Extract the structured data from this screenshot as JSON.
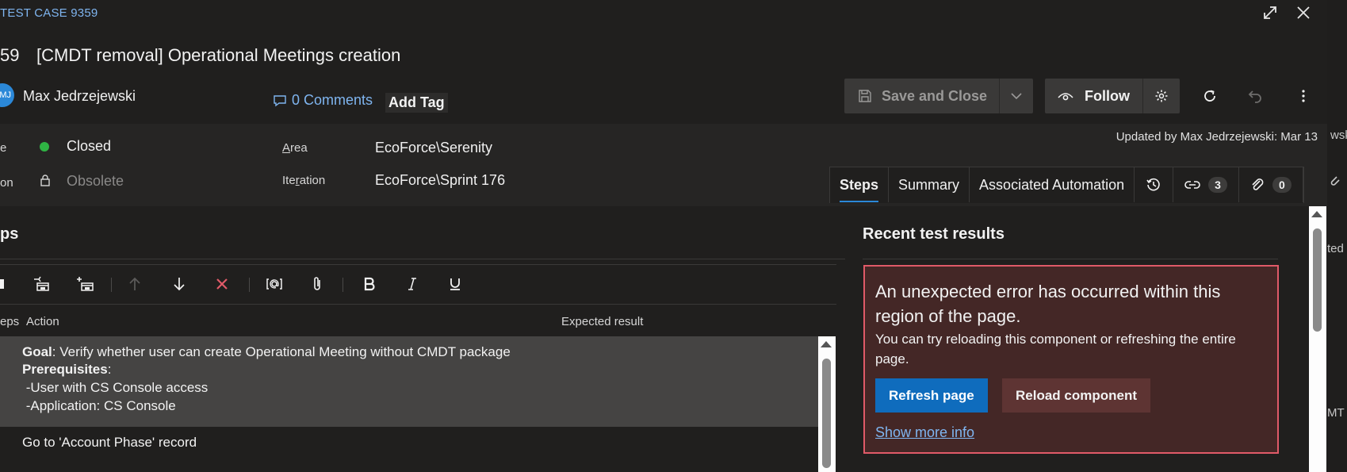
{
  "header": {
    "type_label": "TEST CASE 9359",
    "id_fragment": "59",
    "title": "[CMDT removal] Operational Meetings creation"
  },
  "assignee": {
    "initials": "MJ",
    "name": "Max Jedrzejewski"
  },
  "comments": {
    "label": "0 Comments"
  },
  "add_tag": {
    "label": "Add Tag"
  },
  "toolbar": {
    "save_label": "Save and Close",
    "follow_label": "Follow"
  },
  "fields": {
    "state_label": "e",
    "state_value": "Closed",
    "reason_label": "on",
    "reason_value": "Obsolete",
    "area_label_prefix": "",
    "area_label_access": "A",
    "area_label_rest": "rea",
    "area_value": "EcoForce\\Serenity",
    "iteration_label_pre": "Ite",
    "iteration_label_access": "r",
    "iteration_label_post": "ation",
    "iteration_value": "EcoForce\\Sprint 176",
    "updated_by": "Updated by Max Jedrzejewski: Mar 13"
  },
  "tabs": {
    "steps": "Steps",
    "summary": "Summary",
    "automation": "Associated Automation",
    "links_count": "3",
    "attachments_count": "0"
  },
  "steps": {
    "heading": "ps",
    "col_steps": "eps",
    "col_action": "Action",
    "col_expected": "Expected result",
    "row1": {
      "goal_label": "Goal",
      "goal_text": ": Verify whether user can create Operational Meeting without CMDT package",
      "prereq_label": "Prerequisites",
      "prereq_colon": ":",
      "prereq_1": " -User with CS Console access",
      "prereq_2": " -Application: CS Console"
    },
    "row2": {
      "action": "Go to 'Account Phase' record"
    }
  },
  "recent_results": {
    "heading": "Recent test results",
    "error_title": "An unexpected error has occurred within this region of the page.",
    "error_desc": "You can try reloading this component or refreshing the entire page.",
    "refresh_label": "Refresh page",
    "reload_label": "Reload component",
    "show_more_label": "Show more info"
  },
  "background": {
    "text_1": "wsk",
    "text_2": "ted",
    "text_3": "MT"
  },
  "colors": {
    "accent": "#2b88d8",
    "link": "#7fb5f0",
    "state_closed": "#2fb344",
    "error_border": "#e05a68",
    "error_bg": "#442726"
  }
}
